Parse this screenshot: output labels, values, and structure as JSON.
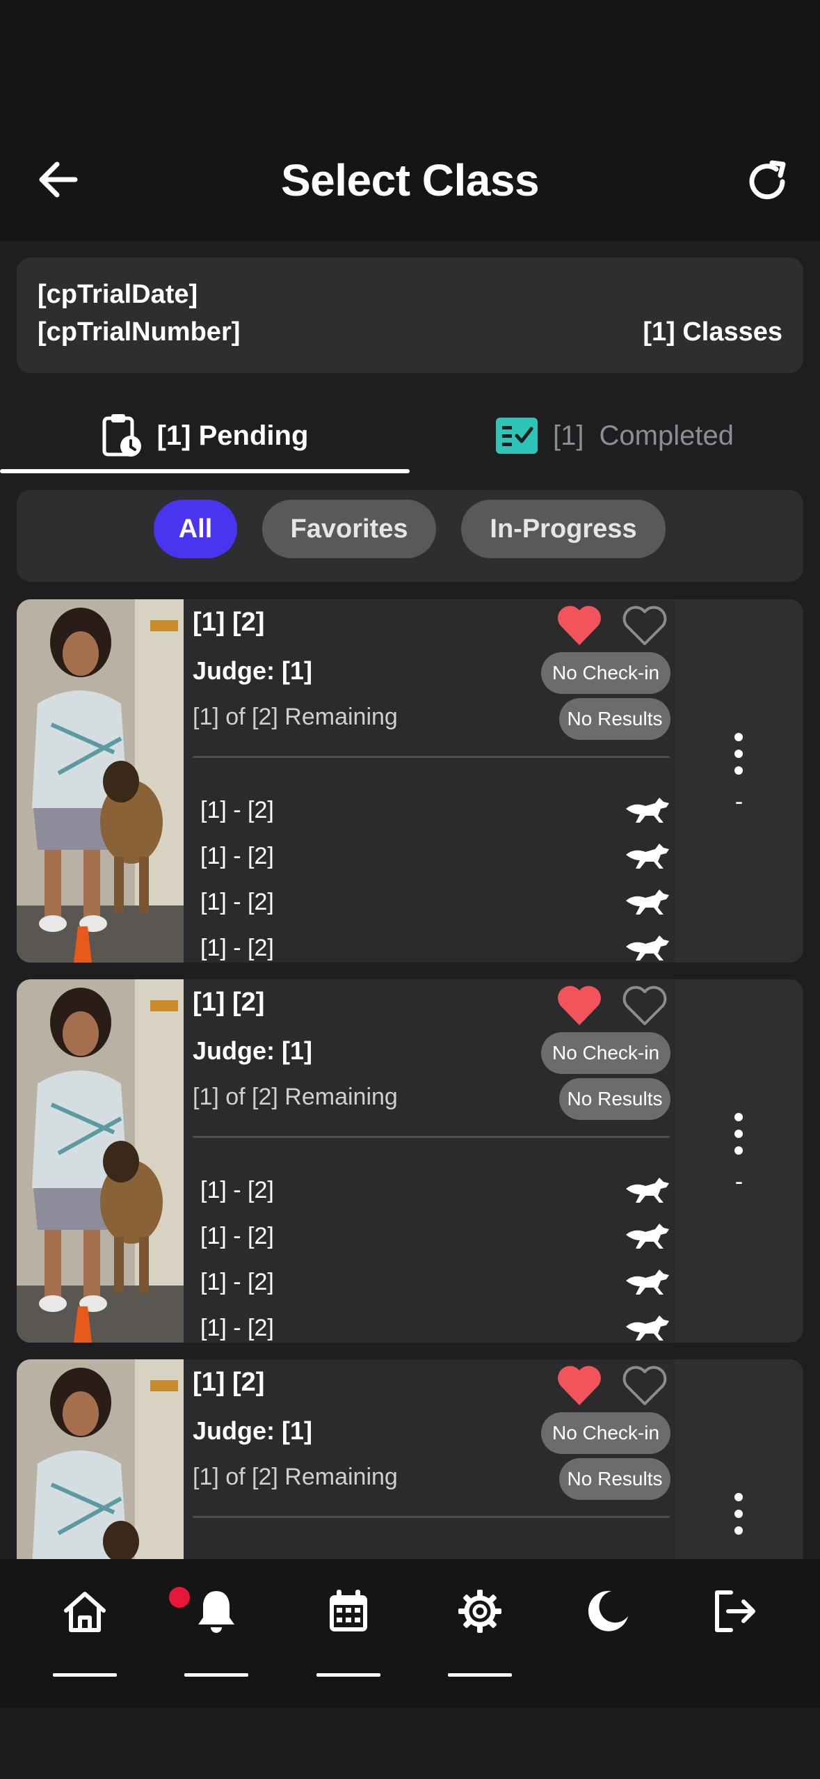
{
  "header": {
    "title": "Select Class",
    "back_icon": "arrow-left-icon",
    "refresh_icon": "refresh-icon"
  },
  "trial": {
    "date": "[cpTrialDate]",
    "number": "[cpTrialNumber]",
    "classes": "[1] Classes"
  },
  "tabs": [
    {
      "label": "[1] Pending",
      "icon": "clipboard-clock-icon",
      "active": true
    },
    {
      "prefix": "[1]",
      "label": "Completed",
      "icon": "checklist-icon",
      "active": false
    }
  ],
  "filters": [
    {
      "label": "All",
      "active": true
    },
    {
      "label": "Favorites",
      "active": false
    },
    {
      "label": "In-Progress",
      "active": false
    }
  ],
  "cards": [
    {
      "title": "[1] [2]",
      "judge": "Judge: [1]",
      "remaining": "[1] of [2] Remaining",
      "checkin_badge": "No Check-in",
      "results_badge": "No Results",
      "side_value": "-",
      "entries": [
        "[1] - [2]",
        "[1] - [2]",
        "[1] - [2]",
        "[1] - [2]"
      ]
    },
    {
      "title": "[1] [2]",
      "judge": "Judge: [1]",
      "remaining": "[1] of [2] Remaining",
      "checkin_badge": "No Check-in",
      "results_badge": "No Results",
      "side_value": "-",
      "entries": [
        "[1] - [2]",
        "[1] - [2]",
        "[1] - [2]",
        "[1] - [2]"
      ]
    },
    {
      "title": "[1] [2]",
      "judge": "Judge: [1]",
      "remaining": "[1] of [2] Remaining",
      "checkin_badge": "No Check-in",
      "results_badge": "No Results",
      "side_value": "",
      "entries": []
    }
  ],
  "bottom_nav": [
    {
      "name": "home",
      "icon": "home-icon"
    },
    {
      "name": "notifications",
      "icon": "bell-icon",
      "has_badge": true
    },
    {
      "name": "calendar",
      "icon": "calendar-icon"
    },
    {
      "name": "settings",
      "icon": "gear-icon"
    },
    {
      "name": "theme",
      "icon": "moon-icon"
    },
    {
      "name": "logout",
      "icon": "logout-icon"
    }
  ],
  "colors": {
    "accent": "#4935f0",
    "favorite": "#f2545b",
    "completed_icon": "#2ec4b6",
    "notification_dot": "#e8173a"
  }
}
